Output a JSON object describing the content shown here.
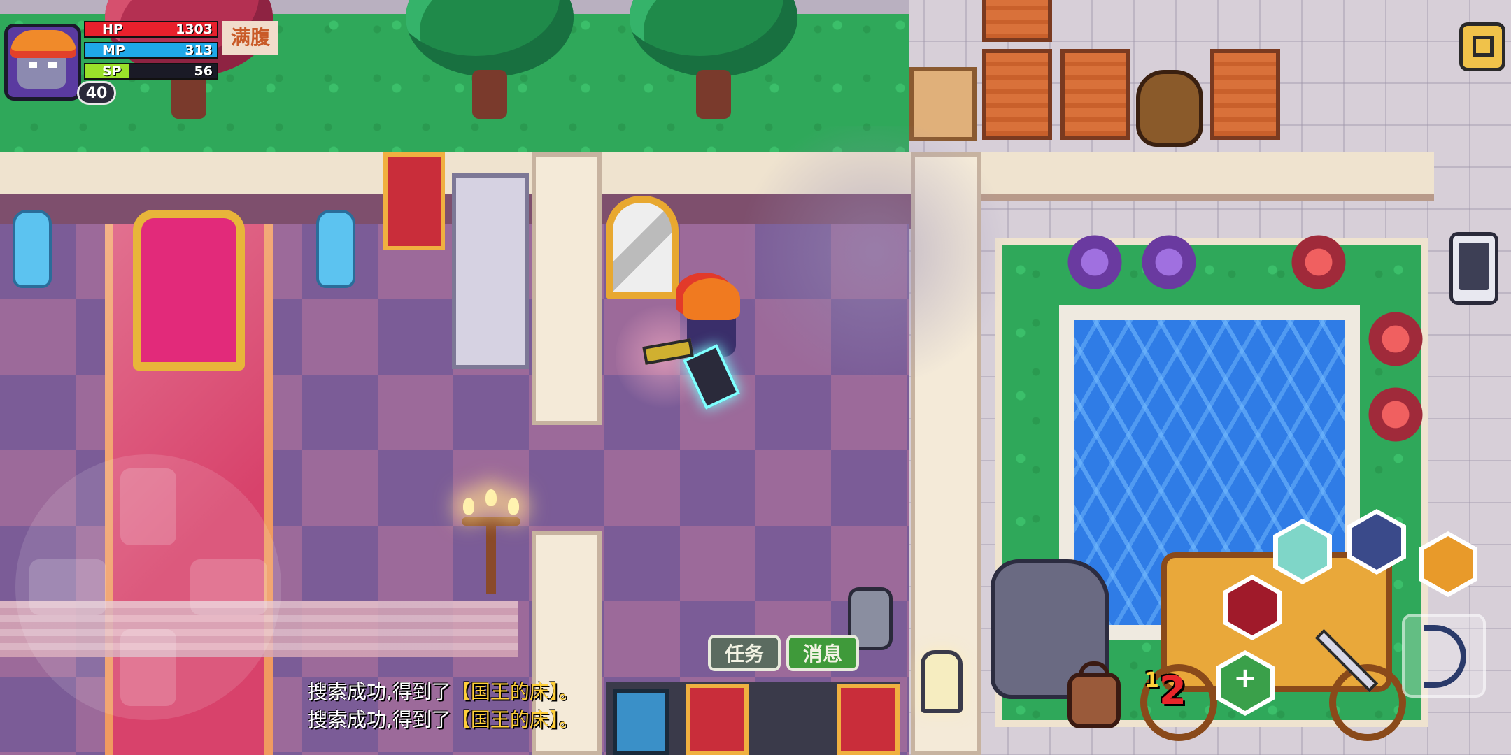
{
  "hud": {
    "level": "40",
    "status_tag": "满腹",
    "stats": [
      {
        "label": "HP",
        "value": "1303",
        "color": "#e8202c",
        "fraction": 1.0
      },
      {
        "label": "MP",
        "value": "313",
        "color": "#1fa8e8",
        "fraction": 1.0
      },
      {
        "label": "SP",
        "value": "56",
        "color": "#9be02a",
        "fraction": 0.33
      }
    ]
  },
  "tabs": {
    "quest": "任务",
    "message": "消息"
  },
  "log": {
    "lines": [
      {
        "prefix": "搜索成功,得到了",
        "item": "【国王的床】",
        "suffix": "。"
      },
      {
        "prefix": "搜索成功,得到了",
        "item": "【国王的床】",
        "suffix": "。"
      }
    ]
  },
  "controls": {
    "hotkey_number": "2",
    "hotkey_marker": "1",
    "skills": [
      "claw-skill-icon",
      "tornado-skill-icon",
      "horse-skill-icon",
      "shield-skill-icon",
      "heal-skill-icon",
      "sword-weapon-icon",
      "bow-weapon-icon"
    ]
  },
  "colors": {
    "accent_gold": "#f0c24a",
    "message_tab": "#3f9a3a",
    "item_text": "#ffcf3a"
  }
}
